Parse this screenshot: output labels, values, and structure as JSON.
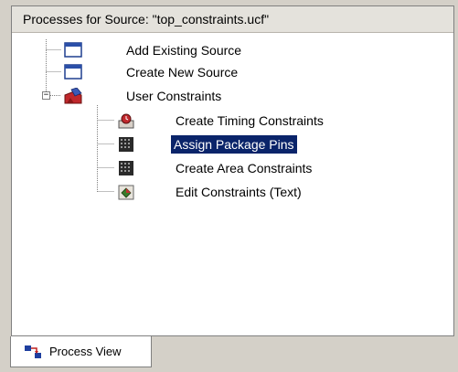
{
  "panel": {
    "title": "Processes for Source:  \"top_constraints.ucf\""
  },
  "tree": {
    "items": [
      {
        "label": "Add Existing Source",
        "icon": "window-icon"
      },
      {
        "label": "Create New Source",
        "icon": "window-icon"
      },
      {
        "label": "User Constraints",
        "icon": "constraints-folder-icon",
        "expanded": true
      },
      {
        "label": "Create Timing Constraints",
        "icon": "timing-icon"
      },
      {
        "label": "Assign Package Pins",
        "icon": "package-grid-icon",
        "selected": true
      },
      {
        "label": "Create Area Constraints",
        "icon": "package-grid-icon"
      },
      {
        "label": "Edit Constraints (Text)",
        "icon": "text-edit-icon"
      }
    ],
    "expander_symbol": "−"
  },
  "tabs": {
    "active_label": "Process View",
    "icon": "process-view-icon"
  },
  "colors": {
    "selection": "#0a246a",
    "background": "#d4d0c8"
  }
}
